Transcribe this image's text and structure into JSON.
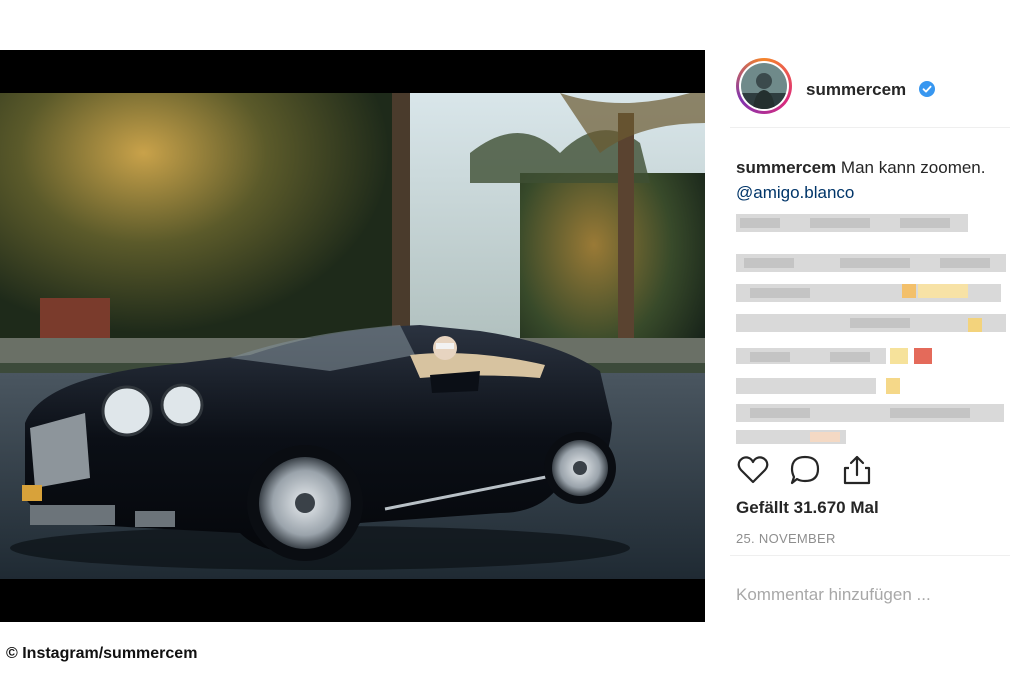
{
  "post": {
    "username": "summercem",
    "verified": true,
    "caption_user": "summercem",
    "caption_text": "Man kann zoomen.",
    "mention": "@amigo.blanco",
    "likes": "Gefällt 31.670 Mal",
    "date": "25. NOVEMBER",
    "comment_placeholder": "Kommentar hinzufügen ..."
  },
  "actions": {
    "like_icon": "heart-icon",
    "comment_icon": "comment-icon",
    "share_icon": "share-icon"
  },
  "credit": "© Instagram/summercem",
  "colors": {
    "verified_blue": "#3897f0",
    "avatar_ring_start": "#f58529",
    "avatar_ring_end": "#dd2a7b",
    "text_primary": "#262626",
    "text_muted": "#8e8e8e",
    "mention_link": "#003569"
  }
}
